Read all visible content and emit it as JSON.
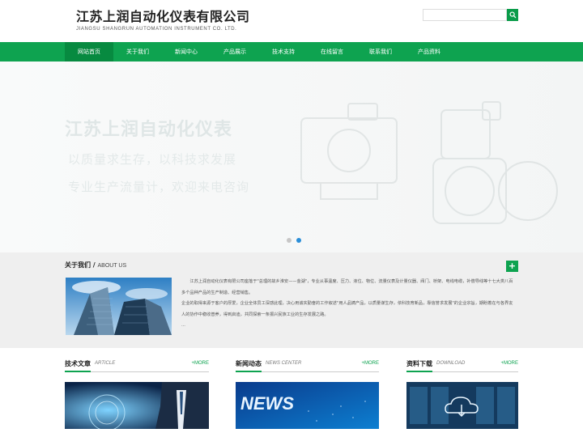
{
  "header": {
    "brand_cn": "江苏上润自动化仪表有限公司",
    "brand_en": "JIANGSU SHANGRUN AUTOMATION INSTRUMENT CO. LTD.",
    "search_placeholder": ""
  },
  "nav": {
    "items": [
      {
        "label": "网站首页"
      },
      {
        "label": "关于我们"
      },
      {
        "label": "新闻中心"
      },
      {
        "label": "产品展示"
      },
      {
        "label": "技术支持"
      },
      {
        "label": "在线留言"
      },
      {
        "label": "联系我们"
      },
      {
        "label": "产品资料"
      }
    ],
    "active_index": 0
  },
  "banner": {
    "line1": "江苏上润自动化仪表",
    "line2": "以质量求生存，以科技求发展",
    "line3": "专业生产流量计，欢迎来电咨询",
    "slides": 2,
    "active_slide": 1
  },
  "about": {
    "title_cn": "关于我们",
    "title_sep": " / ",
    "title_en": "ABOUT US",
    "plus": "+",
    "paragraphs": [
      "　　江苏上润自动化仪表有限公司座落于\"总理的故乡淮安——金湖\"，专业从事温度、压力、液位、物位、流量仪表及计量仪器、阀门、桥架、电线电缆，补偿导线等十七大类八百多个品种产品的生产制造、经营销售。",
      "企业的取得来源于客户的厚爱，企业全体员工深感此理，决心用诚实勤奋的工作叙述\"用人品铸产品，以质量谋生存，依科技育新品，靠信誉求发展\"的企业宗旨，期盼着在与各界友人的协作中稳收普养，得到启迪，共同探索一条振兴民族工业的生存发展之路。",
      "..."
    ]
  },
  "columns": [
    {
      "title_cn": "技术文章",
      "title_en": "ARTICLE",
      "more": "+MORE"
    },
    {
      "title_cn": "新闻动态",
      "title_en": "NEWS CENTER",
      "more": "+MORE"
    },
    {
      "title_cn": "资料下载",
      "title_en": "DOWNLOAD",
      "more": "+MORE"
    }
  ],
  "colors": {
    "brand_green": "#0ea350",
    "nav_active": "#078a40"
  }
}
